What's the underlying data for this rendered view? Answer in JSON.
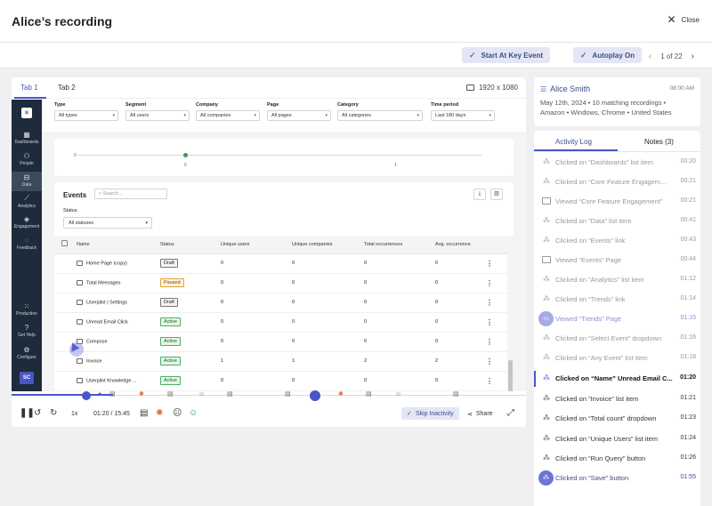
{
  "header": {
    "title": "Alice’s recording",
    "close_label": "Close"
  },
  "toolbar": {
    "start_key_event": "Start At Key Event",
    "autoplay": "Autoplay On",
    "pager": "1 of 22"
  },
  "player": {
    "tabs": [
      "Tab 1",
      "Tab 2"
    ],
    "resolution": "1920 x 1080",
    "nav": [
      "Dashboards",
      "People",
      "Data",
      "Analytics",
      "Engagement",
      "Feedback",
      "Production",
      "Get Help",
      "Configure"
    ],
    "nav_avatar": "SC",
    "filters": [
      {
        "label": "Type",
        "value": "All types"
      },
      {
        "label": "Segment",
        "value": "All users"
      },
      {
        "label": "Company",
        "value": "All companies"
      },
      {
        "label": "Page",
        "value": "All pages"
      },
      {
        "label": "Category",
        "value": "All categories"
      },
      {
        "label": "Time period",
        "value": "Last 180 days"
      }
    ],
    "chart_ticks": [
      "0",
      "0",
      "1"
    ],
    "events": {
      "title": "Events",
      "search_placeholder": "Search...",
      "status_label": "Status",
      "status_value": "All statuses",
      "columns": [
        "Name",
        "Status",
        "Unique users",
        "Unique companies",
        "Total occurrences",
        "Avg. occurrence"
      ],
      "rows": [
        {
          "name": "Home Page (copy)",
          "status": "Draft",
          "users": "0",
          "companies": "0",
          "total": "0",
          "avg": "0"
        },
        {
          "name": "Total Meesages",
          "status": "Paused",
          "users": "0",
          "companies": "0",
          "total": "0",
          "avg": "0"
        },
        {
          "name": "Userpilot | Settings",
          "status": "Draft",
          "users": "0",
          "companies": "0",
          "total": "0",
          "avg": "0"
        },
        {
          "name": "Unread Email Click",
          "status": "Active",
          "users": "0",
          "companies": "0",
          "total": "0",
          "avg": "0"
        },
        {
          "name": "Compose",
          "status": "Active",
          "users": "0",
          "companies": "0",
          "total": "0",
          "avg": "0"
        },
        {
          "name": "Invoice",
          "status": "Active",
          "users": "1",
          "companies": "1",
          "total": "2",
          "avg": "2"
        },
        {
          "name": "Userpilot Knowledge ...",
          "status": "Active",
          "users": "0",
          "companies": "0",
          "total": "0",
          "avg": "0"
        }
      ]
    },
    "controls": {
      "speed": "1x",
      "time": "01:20 / 15:45",
      "skip": "Skip Inactivity",
      "share": "Share"
    }
  },
  "user": {
    "name": "Alice Smith",
    "time": "08:00 AM",
    "meta_line1": "May 12th, 2024 • 10 matching recordings •",
    "meta_line2": "Amazon • Windows, Chrome • United States"
  },
  "activity": {
    "tabs": [
      "Activity Log",
      "Notes (3)"
    ],
    "items": [
      {
        "text": "Clicked on “Dashboards” list item",
        "time": "00:20"
      },
      {
        "text": "Clicked on “Core Feature Engagem...",
        "time": "00:21"
      },
      {
        "text": "Viewed “Core Feature Engagement”",
        "time": "00:21"
      },
      {
        "text": "Clicked on “Data” list item",
        "time": "00:41"
      },
      {
        "text": "Clicked on “Events” link",
        "time": "00:43"
      },
      {
        "text": "Viewed “Events” Page",
        "time": "00:44"
      },
      {
        "text": "Clicked on “Analytics” list item",
        "time": "01:12"
      },
      {
        "text": "Clicked on “Trends” link",
        "time": "01:14"
      },
      {
        "text": "Viewed “Trends” Page",
        "time": "01:15"
      },
      {
        "text": "Clicked on “Select Event” dropdown",
        "time": "01:16"
      },
      {
        "text": "Clicked on “Any Event” list item",
        "time": "01:18"
      },
      {
        "text": "Clicked on “Name”  Unread Email C...",
        "time": "01:20"
      },
      {
        "text": "Clicked on “Invoice” list item",
        "time": "01:21"
      },
      {
        "text": "Clicked on “Total count” dropdown",
        "time": "01:23"
      },
      {
        "text": "Clicked on “Unique Users” list item",
        "time": "01:24"
      },
      {
        "text": "Clicked on “Run Query” button",
        "time": "01:26"
      },
      {
        "text": "Clicked on “Save” button",
        "time": "01:55"
      }
    ]
  }
}
